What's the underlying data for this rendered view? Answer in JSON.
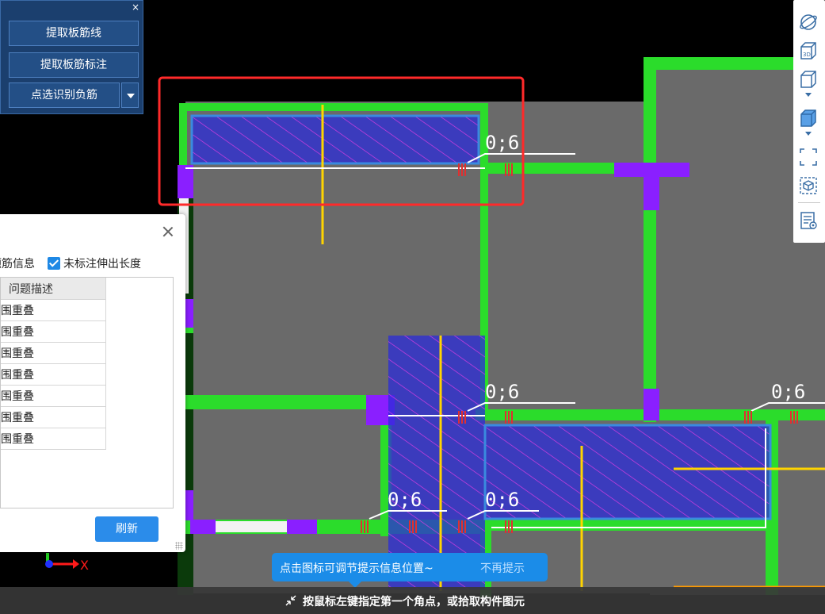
{
  "toolbar": {
    "close_label": "×",
    "extract_rebar_line": "提取板筋线",
    "extract_rebar_annotation": "提取板筋标注",
    "pick_identify_negative_rebar": "点选识别负筋"
  },
  "dialog": {
    "option_rebar_info": "题筋信息",
    "option_unmarked_extension": "未标注伸出长度",
    "option_unmarked_extension_checked": true,
    "table_header": "问题描述",
    "rows": [
      "围重叠",
      "围重叠",
      "围重叠",
      "围重叠",
      "围重叠",
      "围重叠",
      "围重叠"
    ],
    "refresh_label": "刷新"
  },
  "drawing": {
    "annotations": [
      "0;6",
      "0;6",
      "0;6",
      "0;6",
      "0;6"
    ],
    "axis_x_label": "X"
  },
  "tip": {
    "message": "点击图标可调节提示信息位置~",
    "dismiss": "不再提示"
  },
  "status_bar": {
    "message": "按鼠标左键指定第一个角点，或拾取构件图元"
  },
  "right_toolbar": {
    "icons": [
      "orbit-icon",
      "3d-view-icon",
      "box-wire-icon",
      "box-solid-icon",
      "full-screen-icon",
      "select-3d-icon",
      "property-list-icon"
    ]
  },
  "colors": {
    "wall": "#2bdc2b",
    "slab": "#6a6a6a",
    "rebar_zone": "#2a2ad8",
    "hatch": "#d43ce0",
    "rebar_line": "#ffd400",
    "highlight_box": "#ff2a2a",
    "accent": "#1b8ce8"
  }
}
